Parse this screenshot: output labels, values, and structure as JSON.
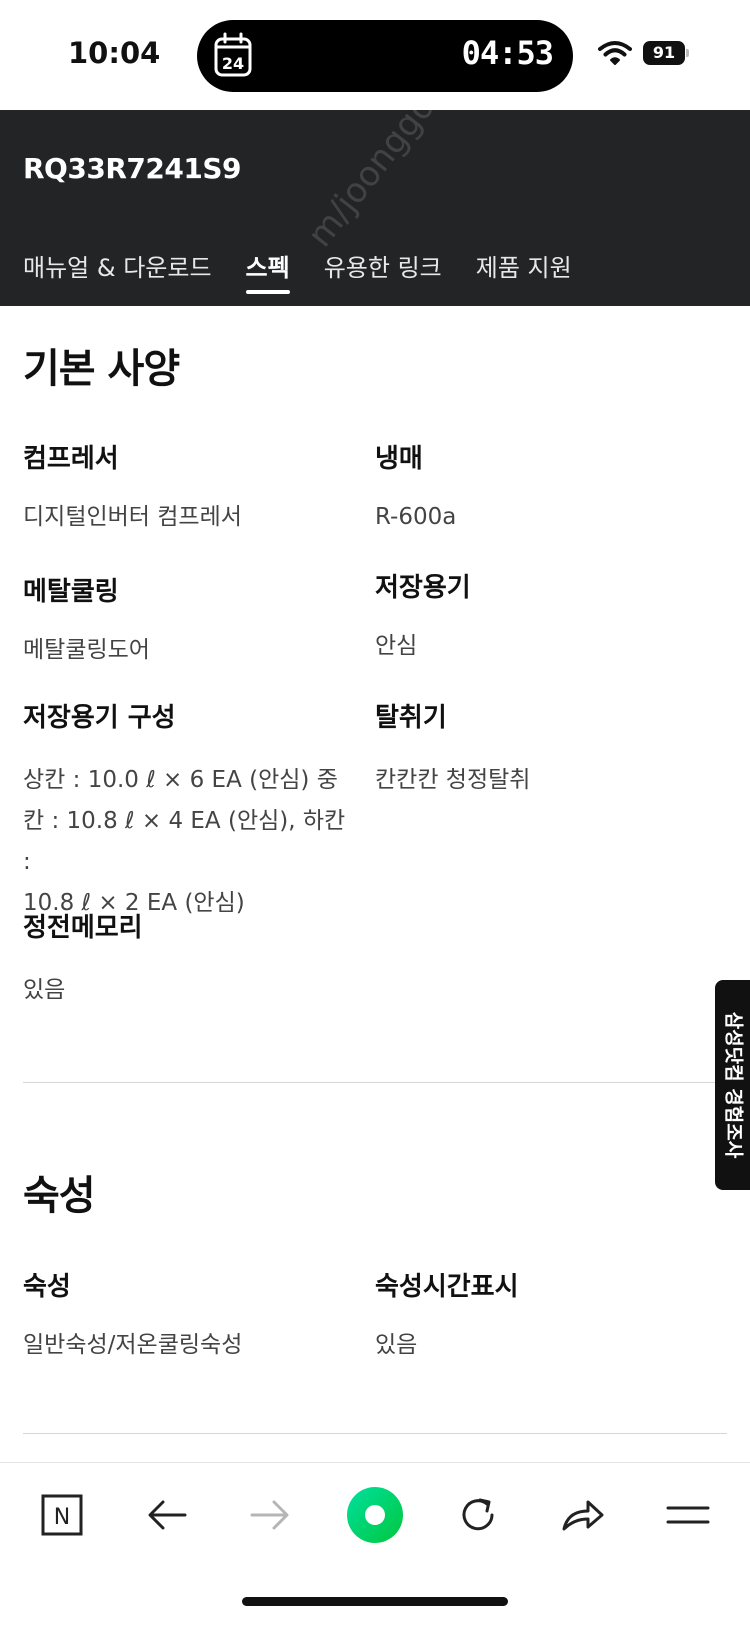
{
  "status_bar": {
    "time": "10:04",
    "calendar_day": "24",
    "island_time": "04:53",
    "battery": "91"
  },
  "header": {
    "product_model": "RQ33R7241S9",
    "tabs": [
      {
        "label": "매뉴얼 & 다운로드"
      },
      {
        "label": "스펙"
      },
      {
        "label": "유용한 링크"
      },
      {
        "label": "제품 지원"
      }
    ],
    "active_tab": "스펙",
    "watermark": "m/joonggona"
  },
  "sections": {
    "basic": {
      "title": "기본 사양",
      "specs": [
        {
          "label": "컴프레서",
          "value": "디지털인버터 컴프레서"
        },
        {
          "label": "냉매",
          "value": "R-600a"
        },
        {
          "label": "메탈쿨링",
          "value": "메탈쿨링도어"
        },
        {
          "label": "저장용기",
          "value": "안심"
        },
        {
          "label": "저장용기 구성",
          "value_lines": [
            "상칸 : 10.0 ℓ × 6 EA (안심) 중",
            "칸 : 10.8 ℓ × 4 EA (안심), 하칸 :",
            "10.8 ℓ × 2 EA (안심)"
          ]
        },
        {
          "label": "탈취기",
          "value": "칸칸칸 청정탈취"
        },
        {
          "label": "정전메모리",
          "value": "있음"
        }
      ]
    },
    "aging": {
      "title": "숙성",
      "specs": [
        {
          "label": "숙성",
          "value": "일반숙성/저온쿨링숙성"
        },
        {
          "label": "숙성시간표시",
          "value": "있음"
        }
      ]
    }
  },
  "survey_tab": {
    "label": "삼성닷컴 경험조사"
  },
  "colors": {
    "header_bg": "#222426",
    "accent_green": "#00de5a"
  },
  "bottom_nav": {
    "icons": [
      "naver-n-icon",
      "back-arrow-icon",
      "forward-arrow-icon",
      "green-dot-icon",
      "refresh-icon",
      "share-icon",
      "menu-icon"
    ],
    "naver_letter": "N"
  }
}
